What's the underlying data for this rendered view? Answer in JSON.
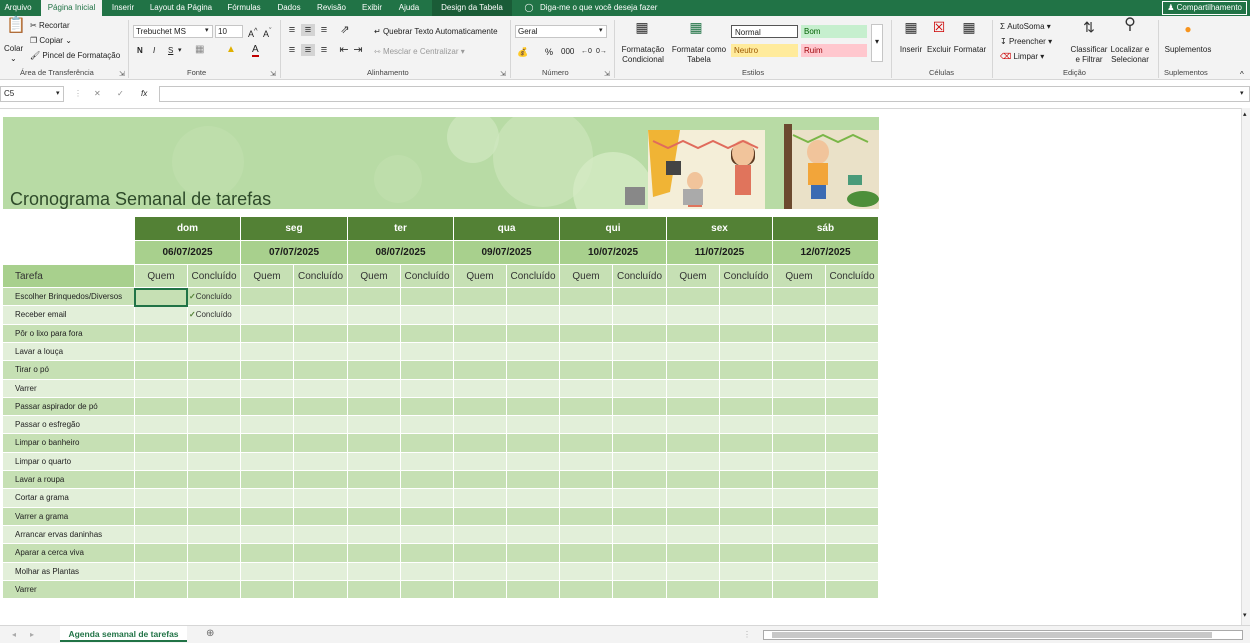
{
  "menu_tabs": [
    "Arquivo",
    "Página Inicial",
    "Inserir",
    "Layout da Página",
    "Fórmulas",
    "Dados",
    "Revisão",
    "Exibir",
    "Ajuda",
    "Design da Tabela"
  ],
  "tell_me": "Diga-me o que você deseja fazer",
  "share": "Compartilhamento",
  "clipboard": {
    "paste": "Colar",
    "cut": "Recortar",
    "copy": "Copiar",
    "format_painter": "Pincel de Formatação",
    "group": "Área de Transferência"
  },
  "font": {
    "name": "Trebuchet MS",
    "size": "10",
    "bold": "N",
    "italic": "I",
    "underline": "S",
    "group": "Fonte"
  },
  "alignment": {
    "wrap": "Quebrar Texto Automaticamente",
    "merge": "Mesclar e Centralizar",
    "group": "Alinhamento"
  },
  "number": {
    "format": "Geral",
    "percent": "%",
    "group": "Número"
  },
  "styles": {
    "cond_format_1": "Formatação",
    "cond_format_2": "Condicional",
    "format_table_1": "Formatar como",
    "format_table_2": "Tabela",
    "normal": "Normal",
    "bom": "Bom",
    "neutro": "Neutro",
    "ruim": "Ruim",
    "group": "Estilos"
  },
  "cells": {
    "insert": "Inserir",
    "delete": "Excluir",
    "format": "Formatar",
    "group": "Células"
  },
  "editing": {
    "autosum": "AutoSoma",
    "fill": "Preencher",
    "clear": "Limpar",
    "sort_1": "Classificar",
    "sort_2": "e Filtrar",
    "find_1": "Localizar e",
    "find_2": "Selecionar",
    "group": "Edição"
  },
  "addins": {
    "label": "Suplementos",
    "group": "Suplementos"
  },
  "formula_bar": {
    "name_box": "C5",
    "cancel": "✕",
    "enter": "✓",
    "fx": "fx",
    "value": ""
  },
  "sheet": {
    "title": "Cronograma Semanal de tarefas",
    "tarefa_header": "Tarefa",
    "quem": "Quem",
    "concluido": "Concluído",
    "days": [
      {
        "day": "dom",
        "date": "06/07/2025"
      },
      {
        "day": "seg",
        "date": "07/07/2025"
      },
      {
        "day": "ter",
        "date": "08/07/2025"
      },
      {
        "day": "qua",
        "date": "09/07/2025"
      },
      {
        "day": "qui",
        "date": "10/07/2025"
      },
      {
        "day": "sex",
        "date": "11/07/2025"
      },
      {
        "day": "sáb",
        "date": "12/07/2025"
      }
    ],
    "tasks": [
      {
        "name": "Escolher Brinquedos/Diversos",
        "done": "Concluído"
      },
      {
        "name": "Receber email",
        "done": "Concluído"
      },
      {
        "name": "Pôr o lixo para fora",
        "done": ""
      },
      {
        "name": "Lavar a louça",
        "done": ""
      },
      {
        "name": "Tirar o pó",
        "done": ""
      },
      {
        "name": "Varrer",
        "done": ""
      },
      {
        "name": "Passar aspirador de pó",
        "done": ""
      },
      {
        "name": "Passar o esfregão",
        "done": ""
      },
      {
        "name": "Limpar o banheiro",
        "done": ""
      },
      {
        "name": "Limpar o quarto",
        "done": ""
      },
      {
        "name": "Lavar a roupa",
        "done": ""
      },
      {
        "name": "Cortar a grama",
        "done": ""
      },
      {
        "name": "Varrer a grama",
        "done": ""
      },
      {
        "name": "Arrancar ervas daninhas",
        "done": ""
      },
      {
        "name": "Aparar a cerca viva",
        "done": ""
      },
      {
        "name": "Molhar as Plantas",
        "done": ""
      },
      {
        "name": "Varrer",
        "done": ""
      }
    ]
  },
  "status": {
    "sheet_tab": "Agenda semanal de tarefas"
  },
  "colors": {
    "excel_green": "#217346",
    "header_dark": "#538135",
    "header_mid": "#a8d08d",
    "row_dark": "#c6e0b4",
    "row_light": "#e2efd9"
  }
}
